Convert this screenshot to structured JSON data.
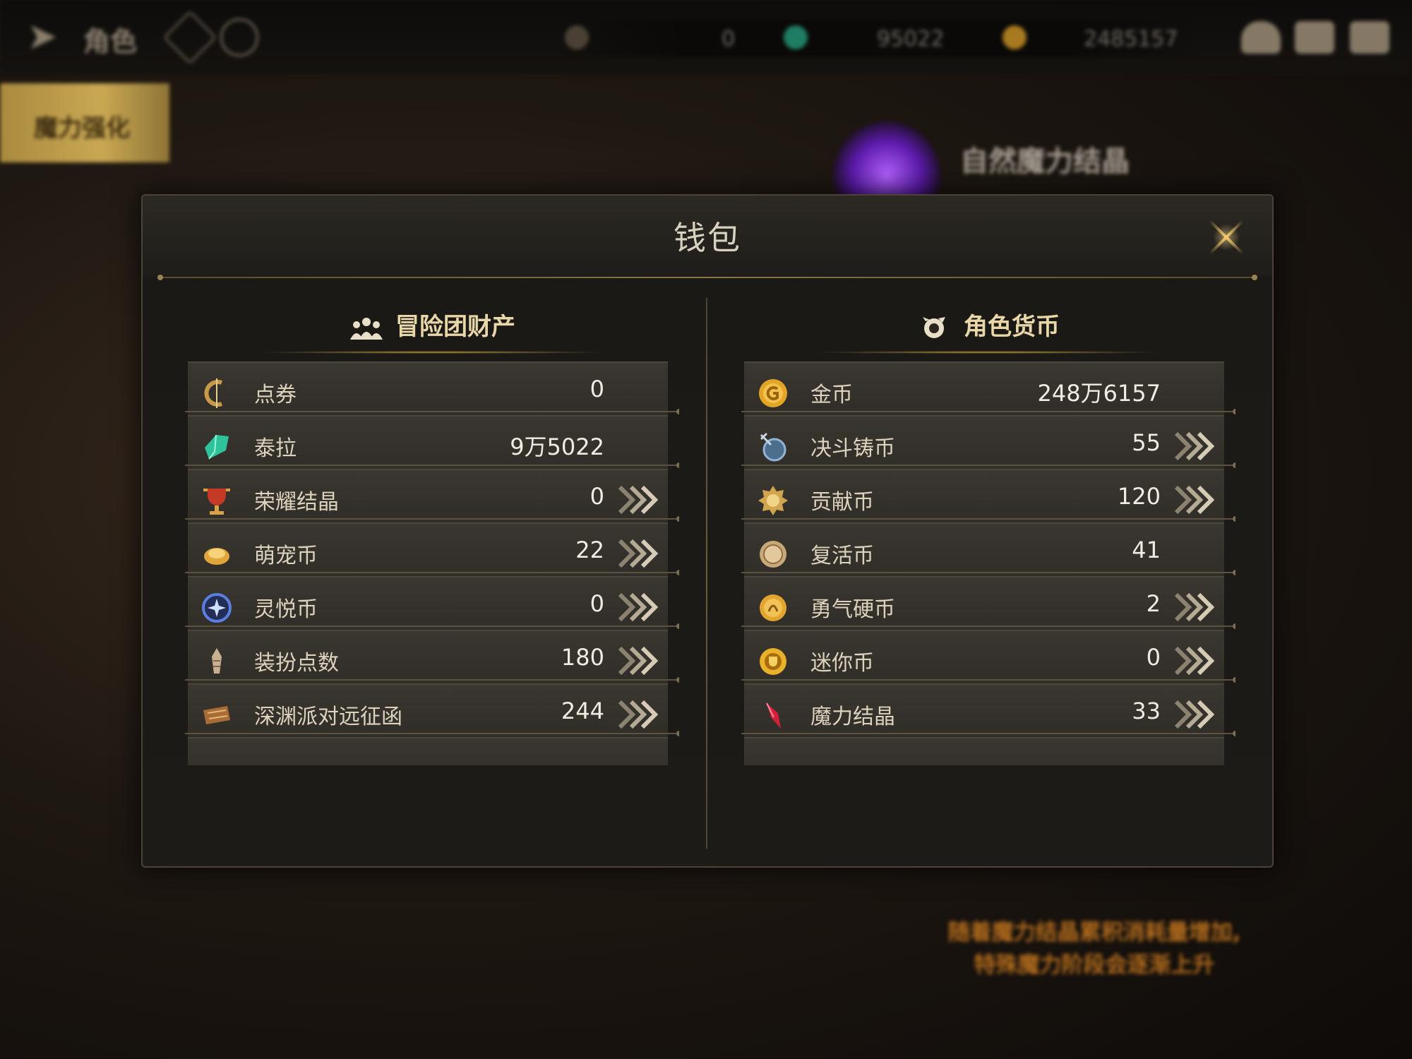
{
  "background": {
    "top_title": "角色",
    "left_tab": "魔力强化",
    "orb_title": "自然魔力结晶",
    "currency_strip": [
      "0",
      "95022",
      "2485157"
    ],
    "warning_lines": [
      "随着魔力结晶累积消耗量增加,",
      "特殊魔力阶段会逐渐上升"
    ]
  },
  "modal": {
    "title": "钱包",
    "left_column": {
      "header": "冒险团财产",
      "header_icon": "group-icon",
      "items": [
        {
          "label": "点券",
          "value": "0",
          "icon": "coupon-icon",
          "has_arrow": false,
          "color": "#c79a4a"
        },
        {
          "label": "泰拉",
          "value": "9万5022",
          "icon": "terra-gem-icon",
          "has_arrow": false,
          "color": "#2fc39c"
        },
        {
          "label": "荣耀结晶",
          "value": "0",
          "icon": "trophy-icon",
          "has_arrow": true,
          "color": "#c43a25"
        },
        {
          "label": "萌宠币",
          "value": "22",
          "icon": "pet-coin-icon",
          "has_arrow": true,
          "color": "#e0a53b"
        },
        {
          "label": "灵悦币",
          "value": "0",
          "icon": "spirit-coin-icon",
          "has_arrow": true,
          "color": "#5a7fe0"
        },
        {
          "label": "装扮点数",
          "value": "180",
          "icon": "costume-point-icon",
          "has_arrow": true,
          "color": "#c8b090"
        },
        {
          "label": "深渊派对远征函",
          "value": "244",
          "icon": "abyss-ticket-icon",
          "has_arrow": true,
          "color": "#a86c34"
        }
      ]
    },
    "right_column": {
      "header": "角色货币",
      "header_icon": "character-coin-icon",
      "items": [
        {
          "label": "金币",
          "value": "248万6157",
          "icon": "gold-coin-icon",
          "has_arrow": false,
          "color": "#e3a525"
        },
        {
          "label": "决斗铸币",
          "value": "55",
          "icon": "duel-coin-icon",
          "has_arrow": true,
          "color": "#8fb4d4"
        },
        {
          "label": "贡献币",
          "value": "120",
          "icon": "contribution-coin-icon",
          "has_arrow": true,
          "color": "#d1a550"
        },
        {
          "label": "复活币",
          "value": "41",
          "icon": "revive-coin-icon",
          "has_arrow": false,
          "color": "#c9a878"
        },
        {
          "label": "勇气硬币",
          "value": "2",
          "icon": "courage-coin-icon",
          "has_arrow": true,
          "color": "#e1a530"
        },
        {
          "label": "迷你币",
          "value": "0",
          "icon": "mini-coin-icon",
          "has_arrow": true,
          "color": "#e9b02c"
        },
        {
          "label": "魔力结晶",
          "value": "33",
          "icon": "magic-crystal-icon",
          "has_arrow": true,
          "color": "#d3203a"
        }
      ]
    }
  }
}
